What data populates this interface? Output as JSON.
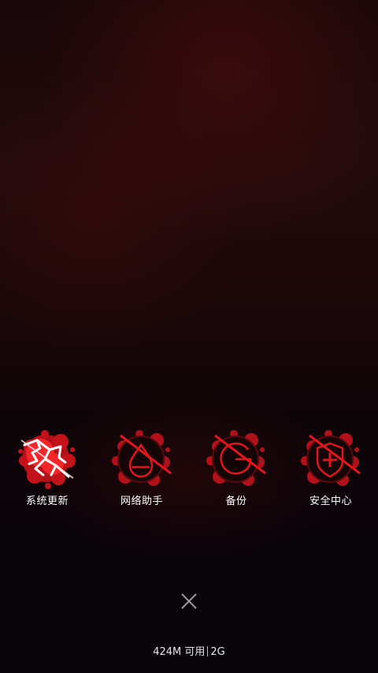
{
  "apps": [
    {
      "label": "系统更新",
      "icon": "system-update-icon"
    },
    {
      "label": "网络助手",
      "icon": "network-assistant-icon"
    },
    {
      "label": "备份",
      "icon": "backup-icon"
    },
    {
      "label": "安全中心",
      "icon": "security-center-icon"
    }
  ],
  "close": {
    "icon": "close-icon"
  },
  "memory": {
    "available": "424M 可用",
    "total": "2G"
  },
  "colors": {
    "accent": "#e0161b",
    "background": "#12060a",
    "text": "#ffffff"
  }
}
